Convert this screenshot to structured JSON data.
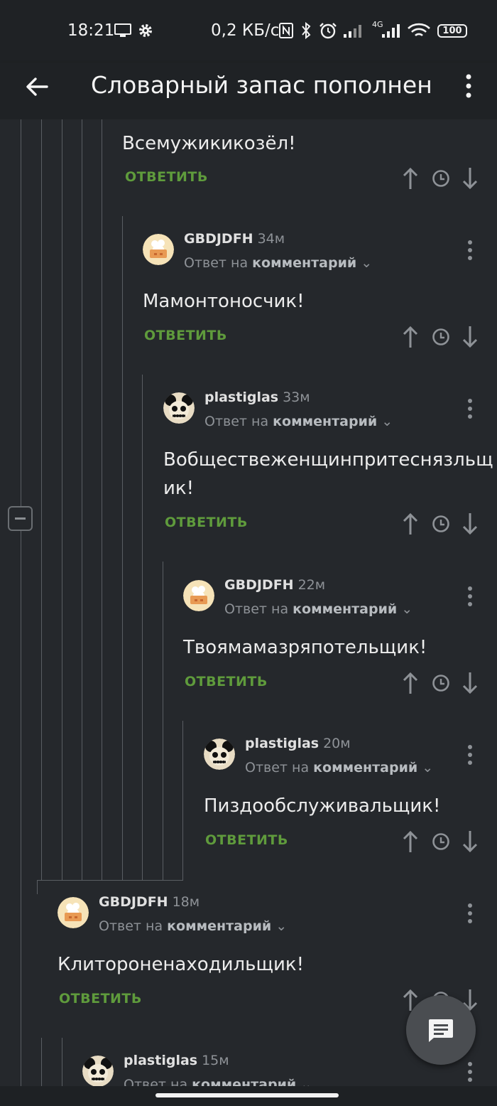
{
  "status": {
    "time": "18:21",
    "speed": "0,2 КБ/с",
    "network": "4G",
    "battery": "100"
  },
  "app": {
    "title": "Словарный запас пополнен"
  },
  "reply_to_prefix": "Ответ на",
  "reply_to_link": "комментарий",
  "reply_label": "ОТВЕТИТЬ",
  "comments": [
    {
      "text": "Всемужикикозёл!"
    },
    {
      "user": "GBDJDFH",
      "time": "34м",
      "text": "Мамонтоносчик!"
    },
    {
      "user": "plastiglas",
      "time": "33м",
      "text_line1": "Вобществеженщинпритеснязльщ",
      "text_line2": "ик!"
    },
    {
      "user": "GBDJDFH",
      "time": "22м",
      "text": "Твоямамазряпотельщик!"
    },
    {
      "user": "plastiglas",
      "time": "20м",
      "text": "Пиздообслуживальщик!"
    },
    {
      "user": "GBDJDFH",
      "time": "18м",
      "text": "Клитороненаходильщик!"
    },
    {
      "user": "plastiglas",
      "time": "15м"
    }
  ],
  "icons": {
    "back": "arrow-left-icon",
    "menu": "more-vert-icon",
    "up": "arrow-up-icon",
    "clock": "clock-icon",
    "down": "arrow-down-icon",
    "fab": "comment-icon"
  }
}
